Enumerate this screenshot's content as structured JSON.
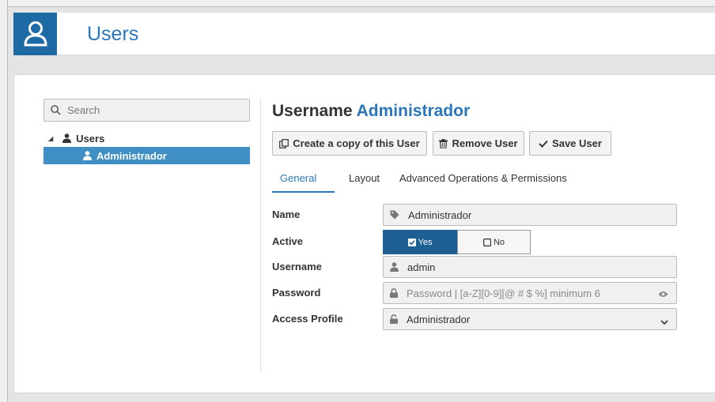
{
  "header": {
    "title": "Users"
  },
  "sidebar": {
    "search": {
      "placeholder": "Search"
    },
    "tree": {
      "root_label": "Users",
      "children": [
        {
          "label": "Administrador",
          "selected": true
        }
      ]
    }
  },
  "main": {
    "title_prefix": "Username",
    "title_value": "Administrador",
    "buttons": {
      "copy_label": "Create a copy of this User",
      "remove_label": "Remove User",
      "save_label": "Save User"
    },
    "tabs": [
      {
        "label": "General",
        "active": true
      },
      {
        "label": "Layout",
        "active": false
      },
      {
        "label": "Advanced Operations & Permissions",
        "active": false
      }
    ],
    "form": {
      "name": {
        "label": "Name",
        "value": "Administrador"
      },
      "active": {
        "label": "Active",
        "yes_label": "Yes",
        "no_label": "No",
        "selected": "Yes"
      },
      "username": {
        "label": "Username",
        "value": "admin"
      },
      "password": {
        "label": "Password",
        "placeholder": "Password | [a-Z][0-9][@ # $ %] minimum 6"
      },
      "access_profile": {
        "label": "Access Profile",
        "value": "Administrador"
      }
    }
  },
  "colors": {
    "accent": "#2a76b8",
    "header_icon_bg": "#1d6aa5",
    "selected_bg": "#3f8fc4",
    "toggle_on": "#1d5f93"
  },
  "icons": [
    "user-icon",
    "search-icon",
    "copy-icon",
    "trash-icon",
    "check-icon",
    "tag-icon",
    "lock-icon",
    "eye-icon",
    "chevron-down-icon"
  ]
}
